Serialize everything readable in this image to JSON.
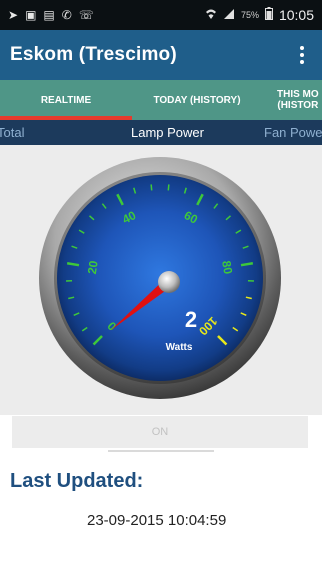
{
  "status_bar": {
    "time": "10:05",
    "battery": "75%",
    "icons": [
      "navigation-icon",
      "notification-icon",
      "image-icon",
      "phone-forward-icon",
      "phone-icon",
      "wifi-icon",
      "signal-icon",
      "battery-icon"
    ]
  },
  "app_bar": {
    "title": "Eskom (Trescimo)"
  },
  "tabs": [
    {
      "label": "REALTIME"
    },
    {
      "label": "TODAY (HISTORY)"
    },
    {
      "label": "THIS MO\n(HISTOR"
    }
  ],
  "sub_tabs": [
    {
      "label": "Total"
    },
    {
      "label": "Lamp Power"
    },
    {
      "label": "Fan Powe"
    }
  ],
  "gauge": {
    "value": 2,
    "value_label": "2",
    "unit_label": "Watts",
    "min": 0,
    "max": 100,
    "tick_labels": [
      "0",
      "20",
      "40",
      "60",
      "80",
      "100"
    ]
  },
  "toggle": {
    "label": "ON"
  },
  "last_updated": {
    "label": "Last Updated:",
    "value": "23-09-2015 10:04:59"
  },
  "colors": {
    "app_bar": "#1f5e8a",
    "tab_bar": "#4f9687",
    "tab_indicator": "#e63a2d",
    "sub_tab_bar": "#1c3a5c",
    "gauge_face": "#1e55b8",
    "tick_green": "#3ec83a",
    "tick_yellow": "#e8e81a",
    "needle": "#e01010",
    "last_updated_text": "#1f4f7f"
  }
}
